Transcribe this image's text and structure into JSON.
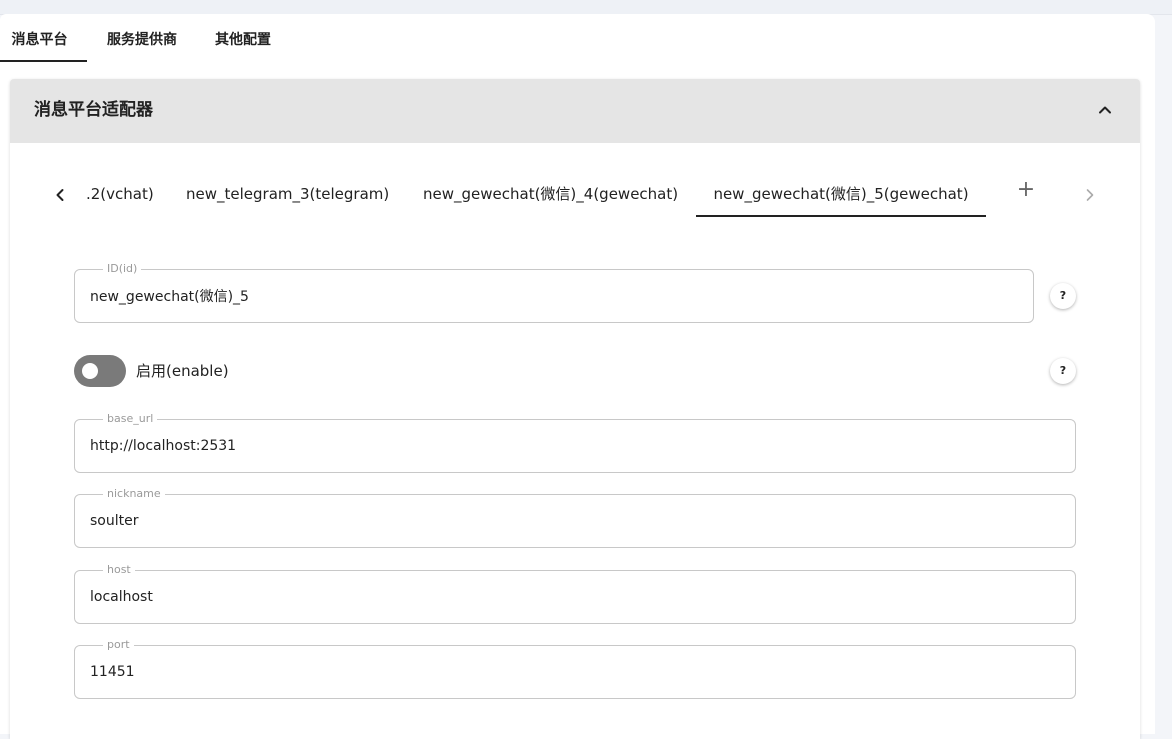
{
  "top_tabs": [
    {
      "label": "消息平台"
    },
    {
      "label": "服务提供商"
    },
    {
      "label": "其他配置"
    }
  ],
  "panel": {
    "title": "消息平台适配器"
  },
  "sub_tabs": [
    {
      "label": ".2(vchat)"
    },
    {
      "label": "new_telegram_3(telegram)"
    },
    {
      "label": "new_gewechat(微信)_4(gewechat)"
    },
    {
      "label": "new_gewechat(微信)_5(gewechat)"
    }
  ],
  "add_tab_label": "+",
  "fields": {
    "id": {
      "label": "ID(id)",
      "value": "new_gewechat(微信)_5"
    },
    "enable": {
      "label": "启用(enable)",
      "checked": false
    },
    "base_url": {
      "label": "base_url",
      "value": "http://localhost:2531"
    },
    "nickname": {
      "label": "nickname",
      "value": "soulter"
    },
    "host": {
      "label": "host",
      "value": "localhost"
    },
    "port": {
      "label": "port",
      "value": "11451"
    }
  },
  "help_label": "?",
  "icons": {
    "collapse": "chevron-up-icon",
    "prev": "chevron-left-icon",
    "next": "chevron-right-icon",
    "add": "plus-icon"
  }
}
